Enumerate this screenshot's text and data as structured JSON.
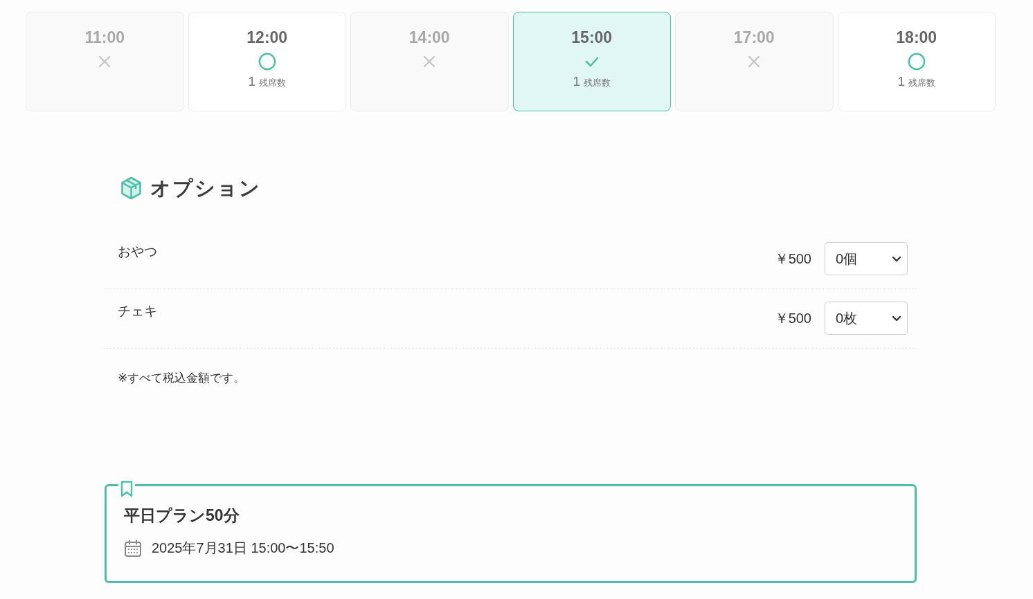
{
  "time_slots": [
    {
      "time": "11:00",
      "disabled": true,
      "selected": false
    },
    {
      "time": "12:00",
      "disabled": false,
      "selected": false,
      "seats": "1",
      "seats_label": "残席数"
    },
    {
      "time": "14:00",
      "disabled": true,
      "selected": false
    },
    {
      "time": "15:00",
      "disabled": false,
      "selected": true,
      "seats": "1",
      "seats_label": "残席数"
    },
    {
      "time": "17:00",
      "disabled": true,
      "selected": false
    },
    {
      "time": "18:00",
      "disabled": false,
      "selected": false,
      "seats": "1",
      "seats_label": "残席数"
    }
  ],
  "options": {
    "title": "オプション",
    "items": [
      {
        "name": "おやつ",
        "price": "￥500",
        "quantity": "0個"
      },
      {
        "name": "チェキ",
        "price": "￥500",
        "quantity": "0枚"
      }
    ],
    "note": "※すべて税込金額です。"
  },
  "plan": {
    "title": "平日プラン50分",
    "datetime": "2025年7月31日 15:00〜15:50"
  }
}
